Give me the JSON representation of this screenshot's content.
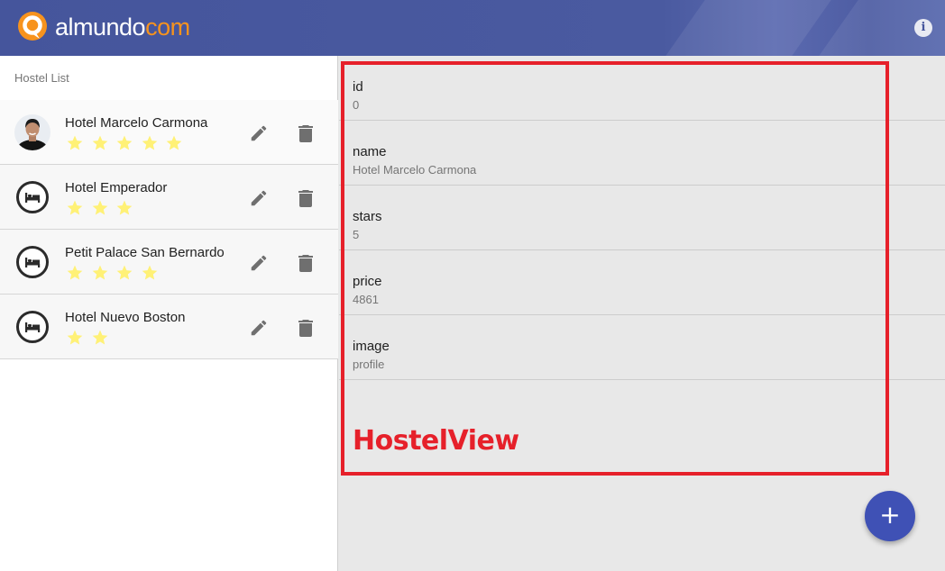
{
  "header": {
    "logo_word1": "almundo",
    "logo_word2": "com",
    "info_icon": "info-icon",
    "info_glyph": "i",
    "brand_orange": "#f7931e",
    "bar_color": "#45559c"
  },
  "sidebar": {
    "title": "Hostel List",
    "items": [
      {
        "name": "Hotel Marcelo Carmona",
        "stars": 5,
        "avatar": "profile-photo"
      },
      {
        "name": "Hotel Emperador",
        "stars": 3,
        "avatar": "bed-icon"
      },
      {
        "name": "Petit Palace San Bernardo",
        "stars": 4,
        "avatar": "bed-icon"
      },
      {
        "name": "Hotel Nuevo Boston",
        "stars": 2,
        "avatar": "bed-icon"
      }
    ],
    "star_color": "#fff176",
    "edit_icon": "pencil-icon",
    "delete_icon": "trash-icon"
  },
  "detail": {
    "fields": [
      {
        "label": "id",
        "value": "0"
      },
      {
        "label": "name",
        "value": "Hotel Marcelo Carmona"
      },
      {
        "label": "stars",
        "value": "5"
      },
      {
        "label": "price",
        "value": "4861"
      },
      {
        "label": "image",
        "value": "profile"
      }
    ]
  },
  "annotation": {
    "label": "HostelView",
    "color": "#e6202a"
  },
  "fab": {
    "label": "+",
    "color": "#3f51b5"
  }
}
